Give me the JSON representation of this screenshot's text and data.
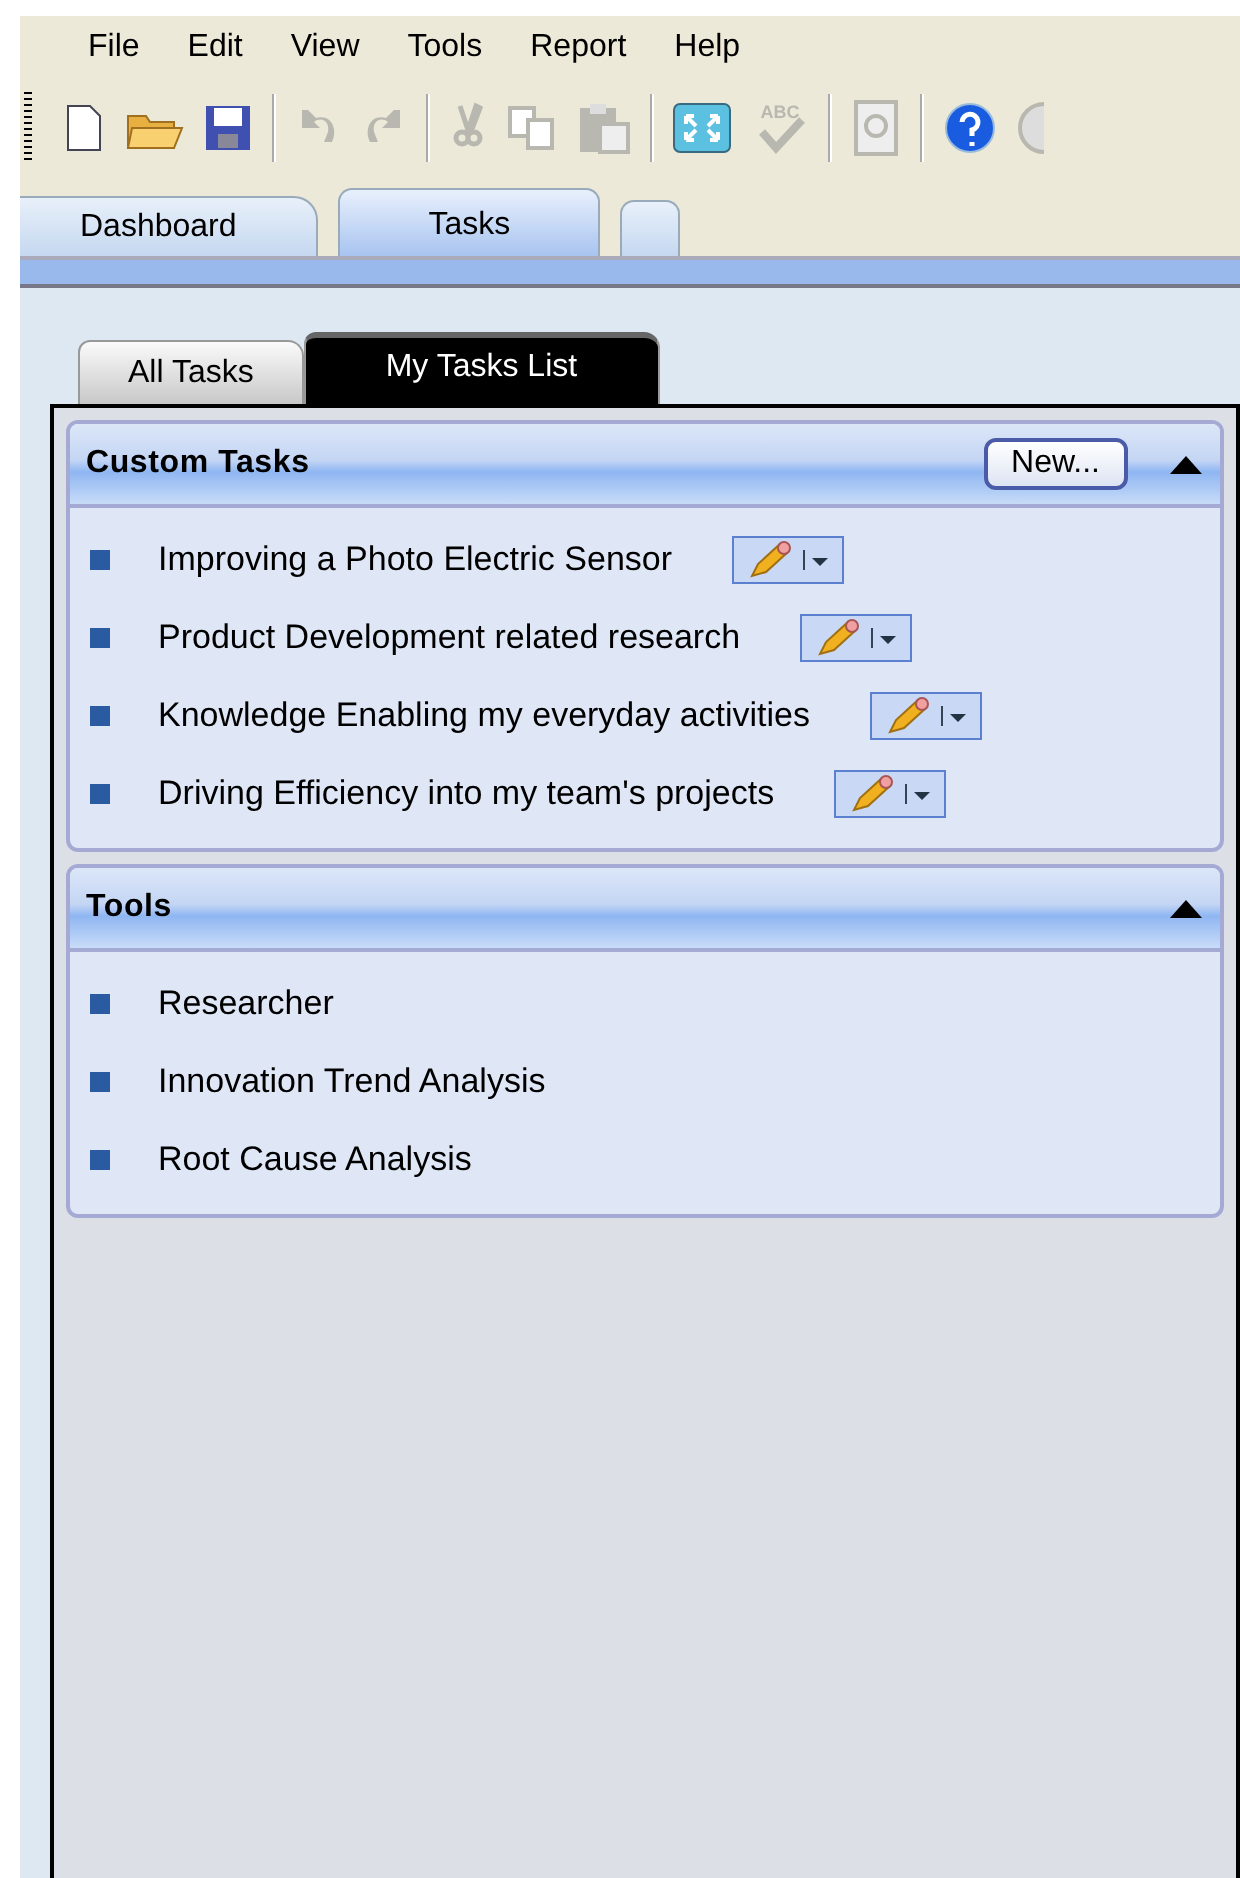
{
  "menu": [
    "File",
    "Edit",
    "View",
    "Tools",
    "Report",
    "Help"
  ],
  "toolbar": [
    {
      "kind": "new",
      "disabled": false
    },
    {
      "kind": "open",
      "disabled": false
    },
    {
      "kind": "save",
      "disabled": false
    },
    {
      "kind": "sep"
    },
    {
      "kind": "undo",
      "disabled": true
    },
    {
      "kind": "redo",
      "disabled": true
    },
    {
      "kind": "sep"
    },
    {
      "kind": "cut",
      "disabled": true
    },
    {
      "kind": "copy",
      "disabled": true
    },
    {
      "kind": "paste",
      "disabled": true
    },
    {
      "kind": "sep"
    },
    {
      "kind": "fit",
      "disabled": false
    },
    {
      "kind": "spell",
      "label": "ABC",
      "disabled": true
    },
    {
      "kind": "sep"
    },
    {
      "kind": "doc",
      "disabled": true
    },
    {
      "kind": "sep"
    },
    {
      "kind": "help",
      "disabled": false
    },
    {
      "kind": "more",
      "disabled": true
    }
  ],
  "doc_tabs": [
    {
      "label": "Dashboard",
      "selected": false
    },
    {
      "label": "Tasks",
      "selected": true
    },
    {
      "selected": false
    }
  ],
  "task_tabs": [
    {
      "label": "All Tasks",
      "selected": false
    },
    {
      "label": "My Tasks List",
      "selected": true
    }
  ],
  "sections": [
    {
      "title": "Custom Tasks",
      "new_button": "New...",
      "expanded": true,
      "items": [
        {
          "label": "Improving a Photo Electric Sensor",
          "editable": true
        },
        {
          "label": "Product Development related research",
          "editable": true
        },
        {
          "label": "Knowledge Enabling my everyday activities",
          "editable": true
        },
        {
          "label": "Driving Efficiency into my team's projects",
          "editable": true
        }
      ]
    },
    {
      "title": "Tools",
      "expanded": true,
      "items": [
        {
          "label": "Researcher",
          "editable": false
        },
        {
          "label": "Innovation Trend Analysis",
          "editable": false
        },
        {
          "label": "Root Cause Analysis",
          "editable": false
        }
      ]
    }
  ]
}
